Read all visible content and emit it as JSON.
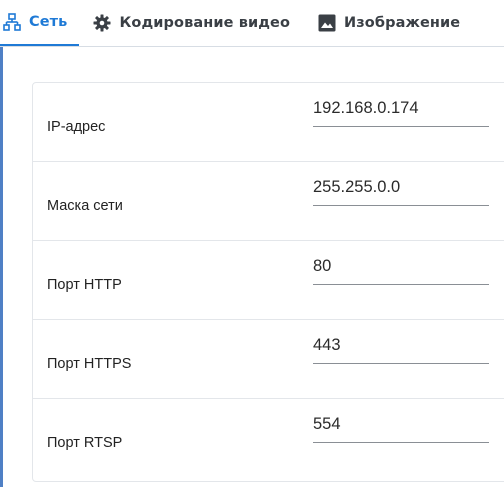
{
  "tabs": [
    {
      "label": "Сеть",
      "icon": "network-icon",
      "active": true
    },
    {
      "label": "Кодирование видео",
      "icon": "gear-icon",
      "active": false
    },
    {
      "label": "Изображение",
      "icon": "image-icon",
      "active": false
    }
  ],
  "colors": {
    "accent": "#1f7ad6",
    "text": "#222222",
    "divider": "#e3e6ea"
  },
  "settings": [
    {
      "label": "IP-адрес",
      "value": "192.168.0.174"
    },
    {
      "label": "Маска сети",
      "value": "255.255.0.0"
    },
    {
      "label": "Порт HTTP",
      "value": "80"
    },
    {
      "label": "Порт HTTPS",
      "value": "443"
    },
    {
      "label": "Порт RTSP",
      "value": "554"
    }
  ]
}
